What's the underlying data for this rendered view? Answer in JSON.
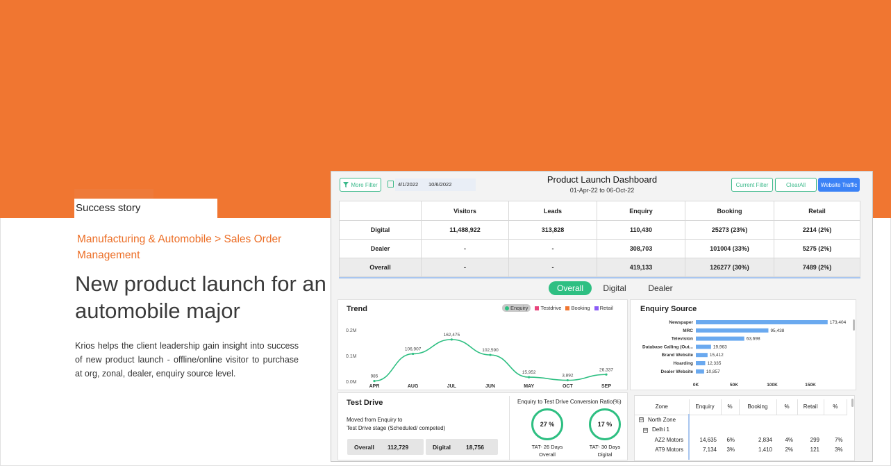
{
  "badge": "Success story",
  "breadcrumb": "Manufacturing & Automobile > Sales Order Management",
  "headline": "New product launch for an automobile major",
  "description": "Krios helps the client leadership gain insight into success of new product launch - offline/online visitor to purchase at org, zonal, dealer, enquiry source level.",
  "colors": {
    "brand_orange": "#f07631",
    "accent_green": "#2ebf82",
    "accent_blue": "#3b82f6"
  },
  "dashboard": {
    "title": "Product Launch Dashboard",
    "subtitle": "01-Apr-22 to 06-Oct-22",
    "more_filter": "More Filter",
    "more_filter_icon": "filter-icon",
    "calendar_icon": "calendar-icon",
    "date_from": "4/1/2022",
    "date_to": "10/6/2022",
    "current_filter": "Current Filter",
    "clear_all": "ClearAll",
    "website_traffic": "Website Traffic",
    "kpi": {
      "columns": [
        "Visitors",
        "Leads",
        "Enquiry",
        "Booking",
        "Retail"
      ],
      "rows": [
        {
          "label": "Digital",
          "values": [
            "11,488,922",
            "313,828",
            "110,430",
            "25273 (23%)",
            "2214 (2%)"
          ]
        },
        {
          "label": "Dealer",
          "values": [
            "-",
            "-",
            "308,703",
            "101004 (33%)",
            "5275 (2%)"
          ]
        },
        {
          "label": "Overall",
          "values": [
            "-",
            "-",
            "419,133",
            "126277 (30%)",
            "7489 (2%)"
          ]
        }
      ]
    },
    "tabs": [
      "Overall",
      "Digital",
      "Dealer"
    ],
    "trend": {
      "title": "Trend",
      "legend": [
        {
          "name": "Enquiry",
          "color": "#2ebf82"
        },
        {
          "name": "Testdrive",
          "color": "#e8457c"
        },
        {
          "name": "Booking",
          "color": "#f07631"
        },
        {
          "name": "Retail",
          "color": "#8b5cf6"
        }
      ]
    },
    "enquiry_source": {
      "title": "Enquiry Source"
    },
    "test_drive": {
      "title": "Test Drive",
      "subtitle_line1": "Moved from Enquiry to",
      "subtitle_line2": "Test Drive stage (Scheduled/ competed)",
      "overall_label": "Overall",
      "overall_value": "112,729",
      "digital_label": "Digital",
      "digital_value": "18,756",
      "conversion_title": "Enquiry to Test Drive Conversion Ratio(%)",
      "ring1_value": "27 %",
      "ring1_label1": "TAT- 26 Days",
      "ring1_label2": "Overall",
      "ring2_value": "17 %",
      "ring2_label1": "TAT- 30 Days",
      "ring2_label2": "Digital"
    },
    "zone_table": {
      "columns": [
        "Zone",
        "Enquiry",
        "%",
        "Booking",
        "%",
        "Retail",
        "%"
      ],
      "rows": [
        {
          "label": "North Zone",
          "expander": "⊟",
          "values": [
            "",
            "",
            "",
            "",
            "",
            ""
          ]
        },
        {
          "label": "Delhi 1",
          "expander": "⊟",
          "values": [
            "",
            "",
            "",
            "",
            "",
            ""
          ]
        },
        {
          "label": "AZ2 Motors",
          "expander": "",
          "values": [
            "14,635",
            "6%",
            "2,834",
            "4%",
            "299",
            "7%"
          ]
        },
        {
          "label": "AT9 Motors",
          "expander": "",
          "values": [
            "7,134",
            "3%",
            "1,410",
            "2%",
            "121",
            "3%"
          ]
        }
      ]
    }
  },
  "chart_data": [
    {
      "type": "line",
      "title": "Trend",
      "categories": [
        "APR",
        "AUG",
        "JUL",
        "JUN",
        "MAY",
        "OCT",
        "SEP"
      ],
      "series": [
        {
          "name": "Enquiry",
          "values": [
            985,
            106907,
            162475,
            102590,
            15952,
            3892,
            26337
          ]
        }
      ],
      "data_labels": [
        "985",
        "106,907",
        "162,475",
        "102,590",
        "15,952",
        "3,892",
        "26,337"
      ],
      "ylim": [
        0,
        0.2
      ],
      "y_ticks": [
        "0.0M",
        "0.1M",
        "0.2M"
      ],
      "grid": false,
      "legend": "top-right"
    },
    {
      "type": "bar",
      "orientation": "horizontal",
      "title": "Enquiry Source",
      "categories": [
        "Newspaper",
        "MRC",
        "Television",
        "Database Calling (Out...",
        "Brand Website",
        "Hoarding",
        "Dealer Website"
      ],
      "values": [
        173404,
        95438,
        63698,
        19963,
        15412,
        12335,
        10857
      ],
      "data_labels": [
        "173,404",
        "95,438",
        "63,698",
        "19,963",
        "15,412",
        "12,335",
        "10,857"
      ],
      "xlim": [
        0,
        175000
      ],
      "x_ticks": [
        "0K",
        "50K",
        "100K",
        "150K"
      ],
      "bar_color": "#6aa9ef"
    }
  ]
}
